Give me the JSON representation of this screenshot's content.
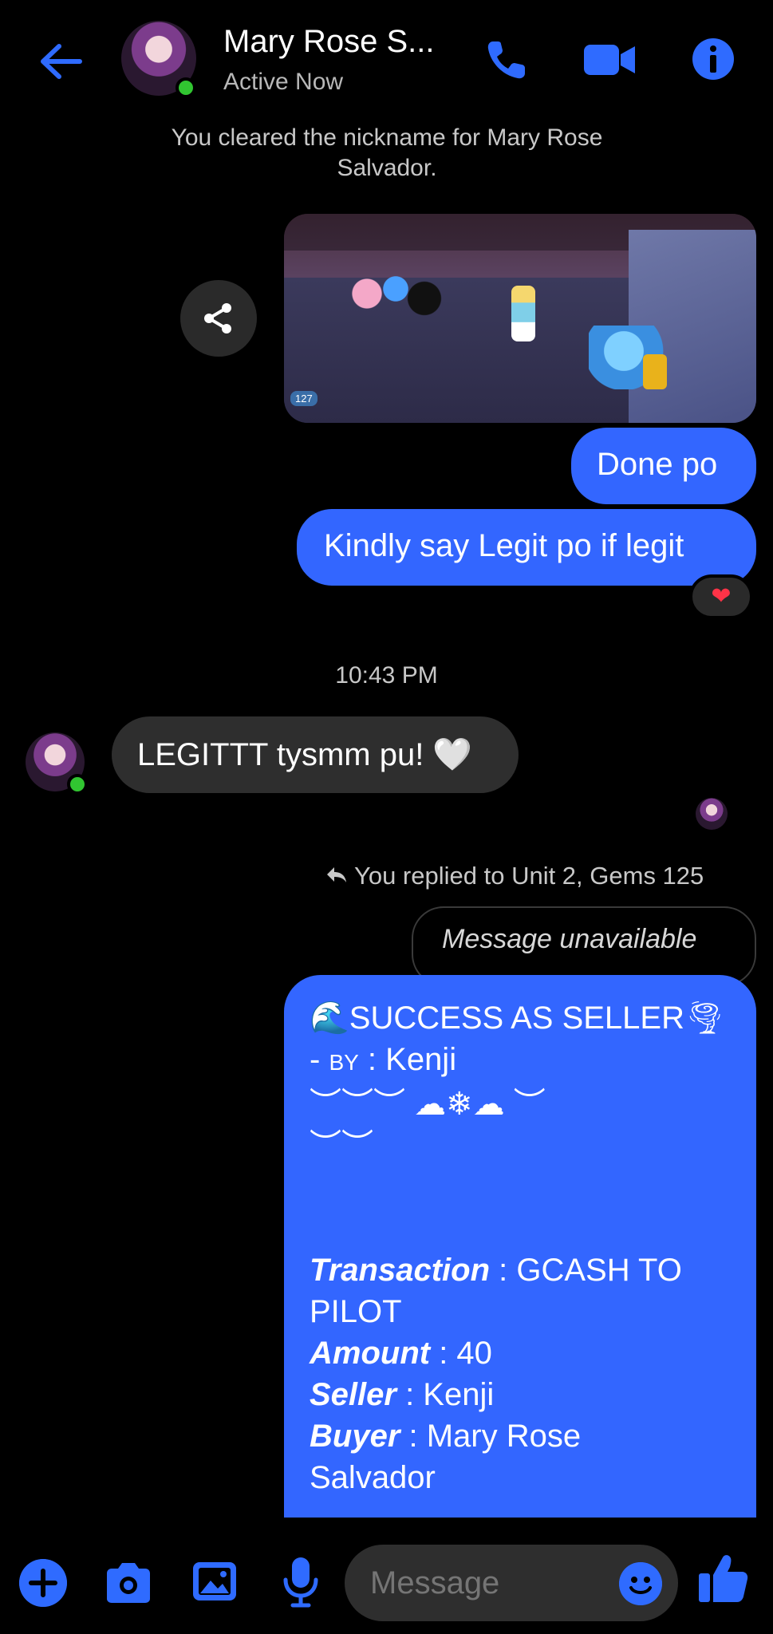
{
  "header": {
    "name": "Mary Rose S...",
    "status": "Active Now"
  },
  "system_note": "You cleared the nickname for Mary Rose Salvador.",
  "shared_image": {
    "gem_count": "127"
  },
  "messages": {
    "done": "Done po",
    "legit_request": "Kindly say Legit po if legit",
    "reaction": "❤",
    "timestamp": "10:43 PM",
    "incoming": "LEGITTT tysmm pu! 🤍"
  },
  "reply": {
    "label": "You replied to Unit 2, Gems 125",
    "quoted": "Message unavailable"
  },
  "card": {
    "title": "🌊SUCCESS AS SELLER🌪",
    "by_prefix": "- ",
    "by_label": "BY",
    "by_value": " : Kenji",
    "decor1": "︶︶︶ ☁❄☁ ︶",
    "decor2": "︶︶",
    "transaction_label": "Transaction",
    "transaction_value": " : GCASH TO",
    "transaction_value2": "PILOT",
    "amount_label": "Amount",
    "amount_value": " : 40",
    "seller_label": "Seller",
    "seller_value": " : Kenji",
    "buyer_label": "Buyer",
    "buyer_value": " : Mary Rose",
    "buyer_value2": "Salvador"
  },
  "composer": {
    "placeholder": "Message"
  },
  "colors": {
    "accent": "#3366ff",
    "online": "#31c531"
  }
}
